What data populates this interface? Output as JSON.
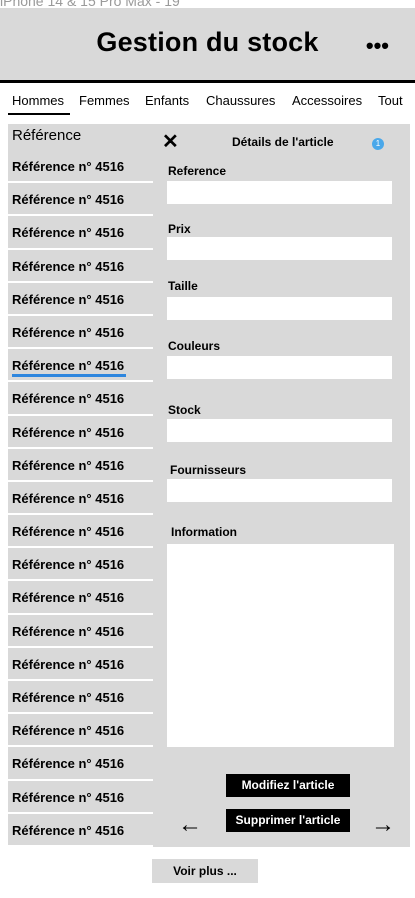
{
  "frame_label": "iPhone 14 & 15 Pro Max - 19",
  "header": {
    "title": "Gestion du stock",
    "more_icon": "more-icon",
    "more_glyph": "•••"
  },
  "tabs": [
    {
      "label": "Hommes",
      "active": true
    },
    {
      "label": "Femmes",
      "active": false
    },
    {
      "label": "Enfants",
      "active": false
    },
    {
      "label": "Chaussures",
      "active": false
    },
    {
      "label": "Accessoires",
      "active": false
    },
    {
      "label": "Tout",
      "active": false
    }
  ],
  "list": {
    "header": "Référence",
    "items": [
      "Référence n° 4516",
      "Référence n° 4516",
      "Référence n° 4516",
      "Référence n° 4516",
      "Référence n° 4516",
      "Référence n° 4516",
      "Référence n° 4516",
      "Référence n° 4516",
      "Référence n° 4516",
      "Référence n° 4516",
      "Référence n° 4516",
      "Référence n° 4516",
      "Référence n° 4516",
      "Référence n° 4516",
      "Référence n° 4516",
      "Référence n° 4516",
      "Référence n° 4516",
      "Référence n° 4516",
      "Référence n° 4516",
      "Référence n° 4516",
      "Référence n° 4516"
    ],
    "selected_index": 6
  },
  "panel": {
    "close_glyph": "✕",
    "title": "Détails de l'article",
    "info_badge": "1",
    "fields": {
      "reference": {
        "label": "Reference",
        "value": ""
      },
      "prix": {
        "label": "Prix",
        "value": ""
      },
      "taille": {
        "label": "Taille",
        "value": ""
      },
      "couleurs": {
        "label": "Couleurs",
        "value": ""
      },
      "stock": {
        "label": "Stock",
        "value": ""
      },
      "fournisseurs": {
        "label": "Fournisseurs",
        "value": ""
      },
      "information": {
        "label": "Information",
        "value": ""
      }
    },
    "modify_button": "Modifiez l'article",
    "delete_button": "Supprimer l'article",
    "prev_glyph": "←",
    "next_glyph": "→"
  },
  "footer": {
    "more_button": "Voir plus ..."
  },
  "colors": {
    "panel_bg": "#d9d9d9",
    "accent_underline": "#2e86de",
    "info_dot": "#4aa8ea",
    "button_bg": "#000000"
  }
}
